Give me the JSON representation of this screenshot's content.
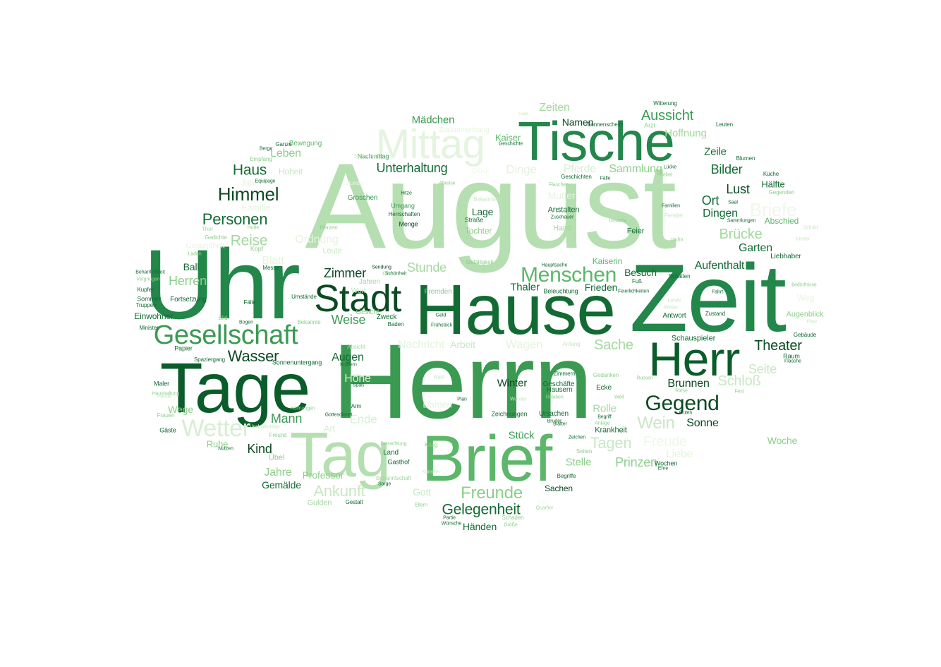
{
  "words": [
    {
      "text": "August",
      "color": "#b5dfb0"
    },
    {
      "text": "Herrn",
      "color": "#3a9a52"
    },
    {
      "text": "Zeit",
      "color": "#23864a"
    },
    {
      "text": "Uhr",
      "color": "#23864a"
    },
    {
      "text": "Hause",
      "color": "#136b34"
    },
    {
      "text": "Tage",
      "color": "#0a5c2a"
    },
    {
      "text": "Brief",
      "color": "#5cb76a"
    },
    {
      "text": "Tag",
      "color": "#b5dfb0"
    },
    {
      "text": "Tische",
      "color": "#23864a"
    },
    {
      "text": "Mittag",
      "color": "#e4f4df"
    },
    {
      "text": "Herr",
      "color": "#0a5c2a"
    },
    {
      "text": "Stadt",
      "color": "#0a4a22"
    },
    {
      "text": "Gesellschaft",
      "color": "#3a9a52"
    },
    {
      "text": "Wetter",
      "color": "#d8eed3"
    },
    {
      "text": "Gegend",
      "color": "#0a4a22"
    },
    {
      "text": "Menschen",
      "color": "#5cb76a"
    },
    {
      "text": "Himmel",
      "color": "#0a4a22"
    },
    {
      "text": "Personen",
      "color": "#136b34"
    },
    {
      "text": "Wasser",
      "color": "#0a4a22"
    },
    {
      "text": "Theater",
      "color": "#0a4a22"
    },
    {
      "text": "Freunde",
      "color": "#8ccf8a"
    },
    {
      "text": "Gelegenheit",
      "color": "#136b34"
    },
    {
      "text": "Ankunft",
      "color": "#c7e8c2"
    },
    {
      "text": "Briefe",
      "color": "#eef8ea"
    },
    {
      "text": "Haus",
      "color": "#136b34"
    },
    {
      "text": "Reise",
      "color": "#a3d89d"
    },
    {
      "text": "Unterhaltung",
      "color": "#136b34"
    },
    {
      "text": "Aussicht",
      "color": "#3a9a52"
    },
    {
      "text": "Zimmer",
      "color": "#0a4a22"
    },
    {
      "text": "Weise",
      "color": "#3a9a52"
    },
    {
      "text": "Mann",
      "color": "#3a9a52"
    },
    {
      "text": "Kind",
      "color": "#0a4a22"
    },
    {
      "text": "Jahre",
      "color": "#8ccf8a"
    },
    {
      "text": "Wein",
      "color": "#c7e8c2"
    },
    {
      "text": "Tagen",
      "color": "#c7e8c2"
    },
    {
      "text": "Freude",
      "color": "#eef8ea"
    },
    {
      "text": "Sache",
      "color": "#a3d89d"
    },
    {
      "text": "Brücke",
      "color": "#a3d89d"
    },
    {
      "text": "Schloß",
      "color": "#c7e8c2"
    },
    {
      "text": "Seite",
      "color": "#c7e8c2"
    },
    {
      "text": "Bilder",
      "color": "#136b34"
    },
    {
      "text": "Lust",
      "color": "#0a4a22"
    },
    {
      "text": "Ort",
      "color": "#136b34"
    },
    {
      "text": "Dingen",
      "color": "#136b34"
    },
    {
      "text": "Garten",
      "color": "#136b34"
    },
    {
      "text": "Aufenthalt",
      "color": "#136b34"
    },
    {
      "text": "Brunnen",
      "color": "#0a4a22"
    },
    {
      "text": "Sonne",
      "color": "#0a4a22"
    },
    {
      "text": "Zeiten",
      "color": "#a3d89d"
    },
    {
      "text": "Hoffnung",
      "color": "#a3d89d"
    },
    {
      "text": "Zeile",
      "color": "#136b34"
    },
    {
      "text": "Mädchen",
      "color": "#3a9a52"
    },
    {
      "text": "Namen",
      "color": "#0a4a22"
    },
    {
      "text": "Kaiser",
      "color": "#5cb76a"
    },
    {
      "text": "Dinge",
      "color": "#e4f4df"
    },
    {
      "text": "Pferde",
      "color": "#d8eed3"
    },
    {
      "text": "Sammlung",
      "color": "#8ccf8a"
    },
    {
      "text": "Mutter",
      "color": "#e4f4df"
    },
    {
      "text": "Lage",
      "color": "#136b34"
    },
    {
      "text": "Tochter",
      "color": "#8ccf8a"
    },
    {
      "text": "Hand",
      "color": "#a3d89d"
    },
    {
      "text": "Feier",
      "color": "#136b34"
    },
    {
      "text": "Frieden",
      "color": "#136b34"
    },
    {
      "text": "Besuch",
      "color": "#136b34"
    },
    {
      "text": "Kaiserin",
      "color": "#5cb76a"
    },
    {
      "text": "Thaler",
      "color": "#136b34"
    },
    {
      "text": "Stunde",
      "color": "#a3d89d"
    },
    {
      "text": "Wagen",
      "color": "#e4f4df"
    },
    {
      "text": "Nachricht",
      "color": "#e4f4df"
    },
    {
      "text": "Arbeit",
      "color": "#c7e8c2"
    },
    {
      "text": "Augen",
      "color": "#136b34"
    },
    {
      "text": "Höhe",
      "color": "#d8eed3"
    },
    {
      "text": "Ende",
      "color": "#d8eed3"
    },
    {
      "text": "Art",
      "color": "#d8eed3"
    },
    {
      "text": "Professor",
      "color": "#8ccf8a"
    },
    {
      "text": "Gulden",
      "color": "#a3d89d"
    },
    {
      "text": "Gott",
      "color": "#c7e8c2"
    },
    {
      "text": "Gemälde",
      "color": "#136b34"
    },
    {
      "text": "Wege",
      "color": "#8ccf8a"
    },
    {
      "text": "Herren",
      "color": "#8ccf8a"
    },
    {
      "text": "Ball",
      "color": "#136b34"
    },
    {
      "text": "Blatt",
      "color": "#e4f4df"
    },
    {
      "text": "Ordnung",
      "color": "#e4f4df"
    },
    {
      "text": "Hoheit",
      "color": "#c7e8c2"
    },
    {
      "text": "Leben",
      "color": "#8ccf8a"
    },
    {
      "text": "Jahr",
      "color": "#e4f4df"
    },
    {
      "text": "Familie",
      "color": "#e4f4df"
    },
    {
      "text": "Gesundheit",
      "color": "#e4f4df"
    },
    {
      "text": "Ruhe",
      "color": "#8ccf8a"
    },
    {
      "text": "Damen",
      "color": "#e4f4df"
    },
    {
      "text": "Winter",
      "color": "#0a4a22"
    },
    {
      "text": "Rolle",
      "color": "#a3d89d"
    },
    {
      "text": "Stelle",
      "color": "#8ccf8a"
    },
    {
      "text": "Prinzen",
      "color": "#8ccf8a"
    },
    {
      "text": "Liebe",
      "color": "#e4f4df"
    },
    {
      "text": "Sachen",
      "color": "#0a4a22"
    },
    {
      "text": "Stück",
      "color": "#3a9a52"
    },
    {
      "text": "Woche",
      "color": "#8ccf8a"
    },
    {
      "text": "Abschied",
      "color": "#5cb76a"
    },
    {
      "text": "Weg",
      "color": "#e4f4df"
    },
    {
      "text": "Bewegung",
      "color": "#5cb76a"
    },
    {
      "text": "Jahren",
      "color": "#a3d89d"
    },
    {
      "text": "Absicht",
      "color": "#a3d89d"
    },
    {
      "text": "Fortsetzung",
      "color": "#136b34"
    },
    {
      "text": "Einwohner",
      "color": "#136b34"
    },
    {
      "text": "Gesicht",
      "color": "#8ccf8a"
    },
    {
      "text": "Wort",
      "color": "#c7e8c2"
    },
    {
      "text": "Zusammenhang",
      "color": "#e4f4df"
    },
    {
      "text": "Glück",
      "color": "#eef8ea"
    },
    {
      "text": "Stunden",
      "color": "#eef8ea"
    },
    {
      "text": "Nachmittag",
      "color": "#3a9a52"
    },
    {
      "text": "Groschen",
      "color": "#3a9a52"
    },
    {
      "text": "Umgang",
      "color": "#3a9a52"
    },
    {
      "text": "Herrschaften",
      "color": "#136b34"
    },
    {
      "text": "Menge",
      "color": "#0a4a22"
    },
    {
      "text": "Leute",
      "color": "#c7e8c2"
    },
    {
      "text": "Sendung",
      "color": "#0a4a22"
    },
    {
      "text": "Schönheit",
      "color": "#136b34"
    },
    {
      "text": "Kopf",
      "color": "#8ccf8a"
    },
    {
      "text": "Messe",
      "color": "#136b34"
    },
    {
      "text": "Fälle",
      "color": "#136b34"
    },
    {
      "text": "Umstände",
      "color": "#136b34"
    },
    {
      "text": "Bekannte",
      "color": "#8ccf8a"
    },
    {
      "text": "Bild",
      "color": "#8ccf8a"
    },
    {
      "text": "Bogen",
      "color": "#136b34"
    },
    {
      "text": "Kindern",
      "color": "#136b34"
    },
    {
      "text": "Spaß",
      "color": "#136b34"
    },
    {
      "text": "Arm",
      "color": "#136b34"
    },
    {
      "text": "Wald",
      "color": "#c7e8c2"
    },
    {
      "text": "Gottesdienst",
      "color": "#136b34"
    },
    {
      "text": "Sonnenuntergang",
      "color": "#136b34"
    },
    {
      "text": "Spaziergang",
      "color": "#136b34"
    },
    {
      "text": "Papier",
      "color": "#136b34"
    },
    {
      "text": "Maler",
      "color": "#136b34"
    },
    {
      "text": "Frauen",
      "color": "#8ccf8a"
    },
    {
      "text": "Gäste",
      "color": "#136b34"
    },
    {
      "text": "Verhältnisse",
      "color": "#c7e8c2"
    },
    {
      "text": "Freund",
      "color": "#8ccf8a"
    },
    {
      "text": "Nutzen",
      "color": "#136b34"
    },
    {
      "text": "Übel",
      "color": "#8ccf8a"
    },
    {
      "text": "Land",
      "color": "#136b34"
    },
    {
      "text": "Betrachtung",
      "color": "#8ccf8a"
    },
    {
      "text": "Gasthof",
      "color": "#136b34"
    },
    {
      "text": "Bekanntschaft",
      "color": "#a3d89d"
    },
    {
      "text": "Sorge",
      "color": "#136b34"
    },
    {
      "text": "Gestalt",
      "color": "#136b34"
    },
    {
      "text": "Eltern",
      "color": "#8ccf8a"
    },
    {
      "text": "Partie",
      "color": "#136b34"
    },
    {
      "text": "Wünsche",
      "color": "#136b34"
    },
    {
      "text": "Händen",
      "color": "#136b34"
    },
    {
      "text": "Größe",
      "color": "#8ccf8a"
    },
    {
      "text": "Schaden",
      "color": "#8ccf8a"
    },
    {
      "text": "Quartier",
      "color": "#a3d89d"
    },
    {
      "text": "Prinz",
      "color": "#eef8ea"
    },
    {
      "text": "Begriffe",
      "color": "#136b34"
    },
    {
      "text": "Zeichnungen",
      "color": "#136b34"
    },
    {
      "text": "Ursachen",
      "color": "#136b34"
    },
    {
      "text": "Bruder",
      "color": "#136b34"
    },
    {
      "text": "Blätter",
      "color": "#136b34"
    },
    {
      "text": "Anlage",
      "color": "#8ccf8a"
    },
    {
      "text": "Begriff",
      "color": "#136b34"
    },
    {
      "text": "Krankheit",
      "color": "#136b34"
    },
    {
      "text": "Hausern",
      "color": "#136b34"
    },
    {
      "text": "Geschäfte",
      "color": "#136b34"
    },
    {
      "text": "Zimmern",
      "color": "#136b34"
    },
    {
      "text": "Gedanken",
      "color": "#8ccf8a"
    },
    {
      "text": "Ecke",
      "color": "#136b34"
    },
    {
      "text": "Russen",
      "color": "#8ccf8a"
    },
    {
      "text": "Riese",
      "color": "#8ccf8a"
    },
    {
      "text": "Ehre",
      "color": "#136b34"
    },
    {
      "text": "Wochen",
      "color": "#136b34"
    },
    {
      "text": "Antwort",
      "color": "#136b34"
    },
    {
      "text": "Schauspieler",
      "color": "#136b34"
    },
    {
      "text": "Zustand",
      "color": "#136b34"
    },
    {
      "text": "Fahrt",
      "color": "#136b34"
    },
    {
      "text": "Augenblick",
      "color": "#8ccf8a"
    },
    {
      "text": "Gebäude",
      "color": "#136b34"
    },
    {
      "text": "Raum",
      "color": "#136b34"
    },
    {
      "text": "Flasche",
      "color": "#136b34"
    },
    {
      "text": "Fest",
      "color": "#8ccf8a"
    },
    {
      "text": "Liebhaber",
      "color": "#136b34"
    },
    {
      "text": "Hälfte",
      "color": "#136b34"
    },
    {
      "text": "Küche",
      "color": "#136b34"
    },
    {
      "text": "Gegenden",
      "color": "#8ccf8a"
    },
    {
      "text": "Blumen",
      "color": "#136b34"
    },
    {
      "text": "Lücke",
      "color": "#136b34"
    },
    {
      "text": "Nebel",
      "color": "#8ccf8a"
    },
    {
      "text": "Arzt",
      "color": "#8ccf8a"
    },
    {
      "text": "Leuten",
      "color": "#136b34"
    },
    {
      "text": "Witterung",
      "color": "#136b34"
    },
    {
      "text": "Sonnenschein",
      "color": "#136b34"
    },
    {
      "text": "Geschichte",
      "color": "#136b34"
    },
    {
      "text": "Geschichten",
      "color": "#136b34"
    },
    {
      "text": "Flaschen",
      "color": "#8ccf8a"
    },
    {
      "text": "Hitze",
      "color": "#136b34"
    },
    {
      "text": "Anstalten",
      "color": "#136b34"
    },
    {
      "text": "Zuschauer",
      "color": "#136b34"
    },
    {
      "text": "Straße",
      "color": "#136b34"
    },
    {
      "text": "Hauptsache",
      "color": "#136b34"
    },
    {
      "text": "Fenster",
      "color": "#c7e8c2"
    },
    {
      "text": "Familien",
      "color": "#136b34"
    },
    {
      "text": "Saal",
      "color": "#136b34"
    },
    {
      "text": "Sammlungen",
      "color": "#136b34"
    },
    {
      "text": "Fuß",
      "color": "#136b34"
    },
    {
      "text": "Feierlichkeiten",
      "color": "#136b34"
    },
    {
      "text": "Schatten",
      "color": "#136b34"
    },
    {
      "text": "Beleuchtung",
      "color": "#136b34"
    },
    {
      "text": "Geld",
      "color": "#136b34"
    },
    {
      "text": "Frühstück",
      "color": "#136b34"
    },
    {
      "text": "Baden",
      "color": "#136b34"
    },
    {
      "text": "Zweck",
      "color": "#136b34"
    },
    {
      "text": "Anfang",
      "color": "#c7e8c2"
    },
    {
      "text": "Kupfer",
      "color": "#136b34"
    },
    {
      "text": "Minister",
      "color": "#136b34"
    },
    {
      "text": "Beharrlichkeit",
      "color": "#136b34"
    },
    {
      "text": "Vergnügen",
      "color": "#8ccf8a"
    },
    {
      "text": "Truppen",
      "color": "#136b34"
    },
    {
      "text": "Sommer",
      "color": "#136b34"
    },
    {
      "text": "Berge",
      "color": "#136b34"
    },
    {
      "text": "Ganze",
      "color": "#136b34"
    },
    {
      "text": "Empfang",
      "color": "#8ccf8a"
    },
    {
      "text": "Equipage",
      "color": "#136b34"
    },
    {
      "text": "Gedichte",
      "color": "#8ccf8a"
    },
    {
      "text": "Laden",
      "color": "#8ccf8a"
    },
    {
      "text": "Thor",
      "color": "#a3d89d"
    },
    {
      "text": "Herzen",
      "color": "#8ccf8a"
    },
    {
      "text": "Fremden",
      "color": "#8ccf8a"
    },
    {
      "text": "Orte",
      "color": "#8ccf8a"
    },
    {
      "text": "Abreise",
      "color": "#8ccf8a"
    },
    {
      "text": "Bekannten",
      "color": "#c7e8c2"
    },
    {
      "text": "Schwester",
      "color": "#c7e8c2"
    },
    {
      "text": "Geist",
      "color": "#c7e8c2"
    },
    {
      "text": "Fälle",
      "color": "#136b34"
    },
    {
      "text": "Krieg",
      "color": "#8ccf8a"
    },
    {
      "text": "Künstler",
      "color": "#c7e8c2"
    },
    {
      "text": "Plan",
      "color": "#136b34"
    },
    {
      "text": "Wunder",
      "color": "#c7e8c2"
    },
    {
      "text": "Relation",
      "color": "#8ccf8a"
    },
    {
      "text": "Weit",
      "color": "#8ccf8a"
    },
    {
      "text": "Seiten",
      "color": "#8ccf8a"
    },
    {
      "text": "Zeichen",
      "color": "#136b34"
    },
    {
      "text": "Gutes",
      "color": "#136b34"
    },
    {
      "text": "Hoffnungen",
      "color": "#8ccf8a"
    },
    {
      "text": "Haushaltung",
      "color": "#8ccf8a"
    },
    {
      "text": "Hände",
      "color": "#c7e8c2"
    },
    {
      "text": "Hütte",
      "color": "#8ccf8a"
    },
    {
      "text": "Ursache",
      "color": "#8ccf8a"
    },
    {
      "text": "Huhn",
      "color": "#8ccf8a"
    },
    {
      "text": "Lande",
      "color": "#c7e8c2"
    },
    {
      "text": "bedürfnisse",
      "color": "#8ccf8a"
    },
    {
      "text": "Kinder",
      "color": "#c7e8c2"
    },
    {
      "text": "Schuld",
      "color": "#c7e8c2"
    },
    {
      "text": "Platz",
      "color": "#c7e8c2"
    },
    {
      "text": "Wetter",
      "color": "#c7e8c2"
    },
    {
      "text": "Gefälligkeit",
      "color": "#8ccf8a"
    },
    {
      "text": "Alter",
      "color": "#8ccf8a"
    },
    {
      "text": "Anlagen",
      "color": "#c7e8c2"
    },
    {
      "text": "Tisch",
      "color": "#c7e8c2"
    },
    {
      "text": "Vorhang",
      "color": "#c7e8c2"
    }
  ]
}
